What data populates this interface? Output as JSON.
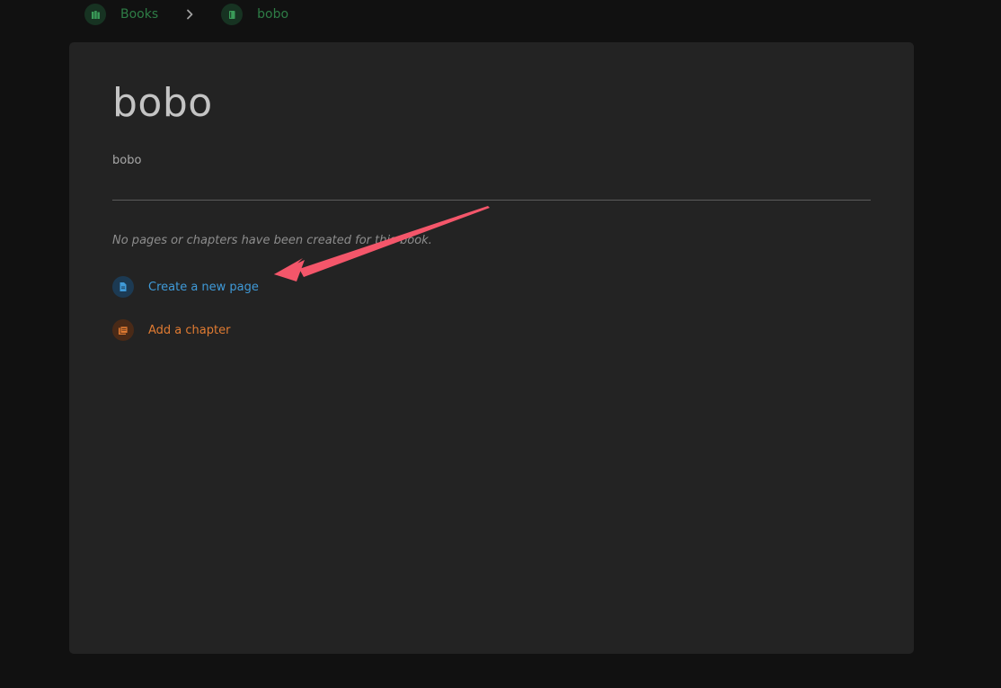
{
  "breadcrumb": {
    "items": [
      {
        "label": "Books",
        "icon": "books-icon"
      },
      {
        "label": "bobo",
        "icon": "book-icon"
      }
    ],
    "separator_icon": "chevron-right-icon"
  },
  "book": {
    "title": "bobo",
    "description": "bobo",
    "empty_message": "No pages or chapters have been created for this book."
  },
  "actions": {
    "create_page": {
      "label": "Create a new page",
      "icon": "page-icon",
      "color": "#3f9ad8"
    },
    "add_chapter": {
      "label": "Add a chapter",
      "icon": "chapter-icon",
      "color": "#e07b32"
    }
  },
  "colors": {
    "background": "#111111",
    "card": "#232323",
    "breadcrumb_accent": "#2e7d46",
    "annotation_arrow": "#f4566a"
  }
}
